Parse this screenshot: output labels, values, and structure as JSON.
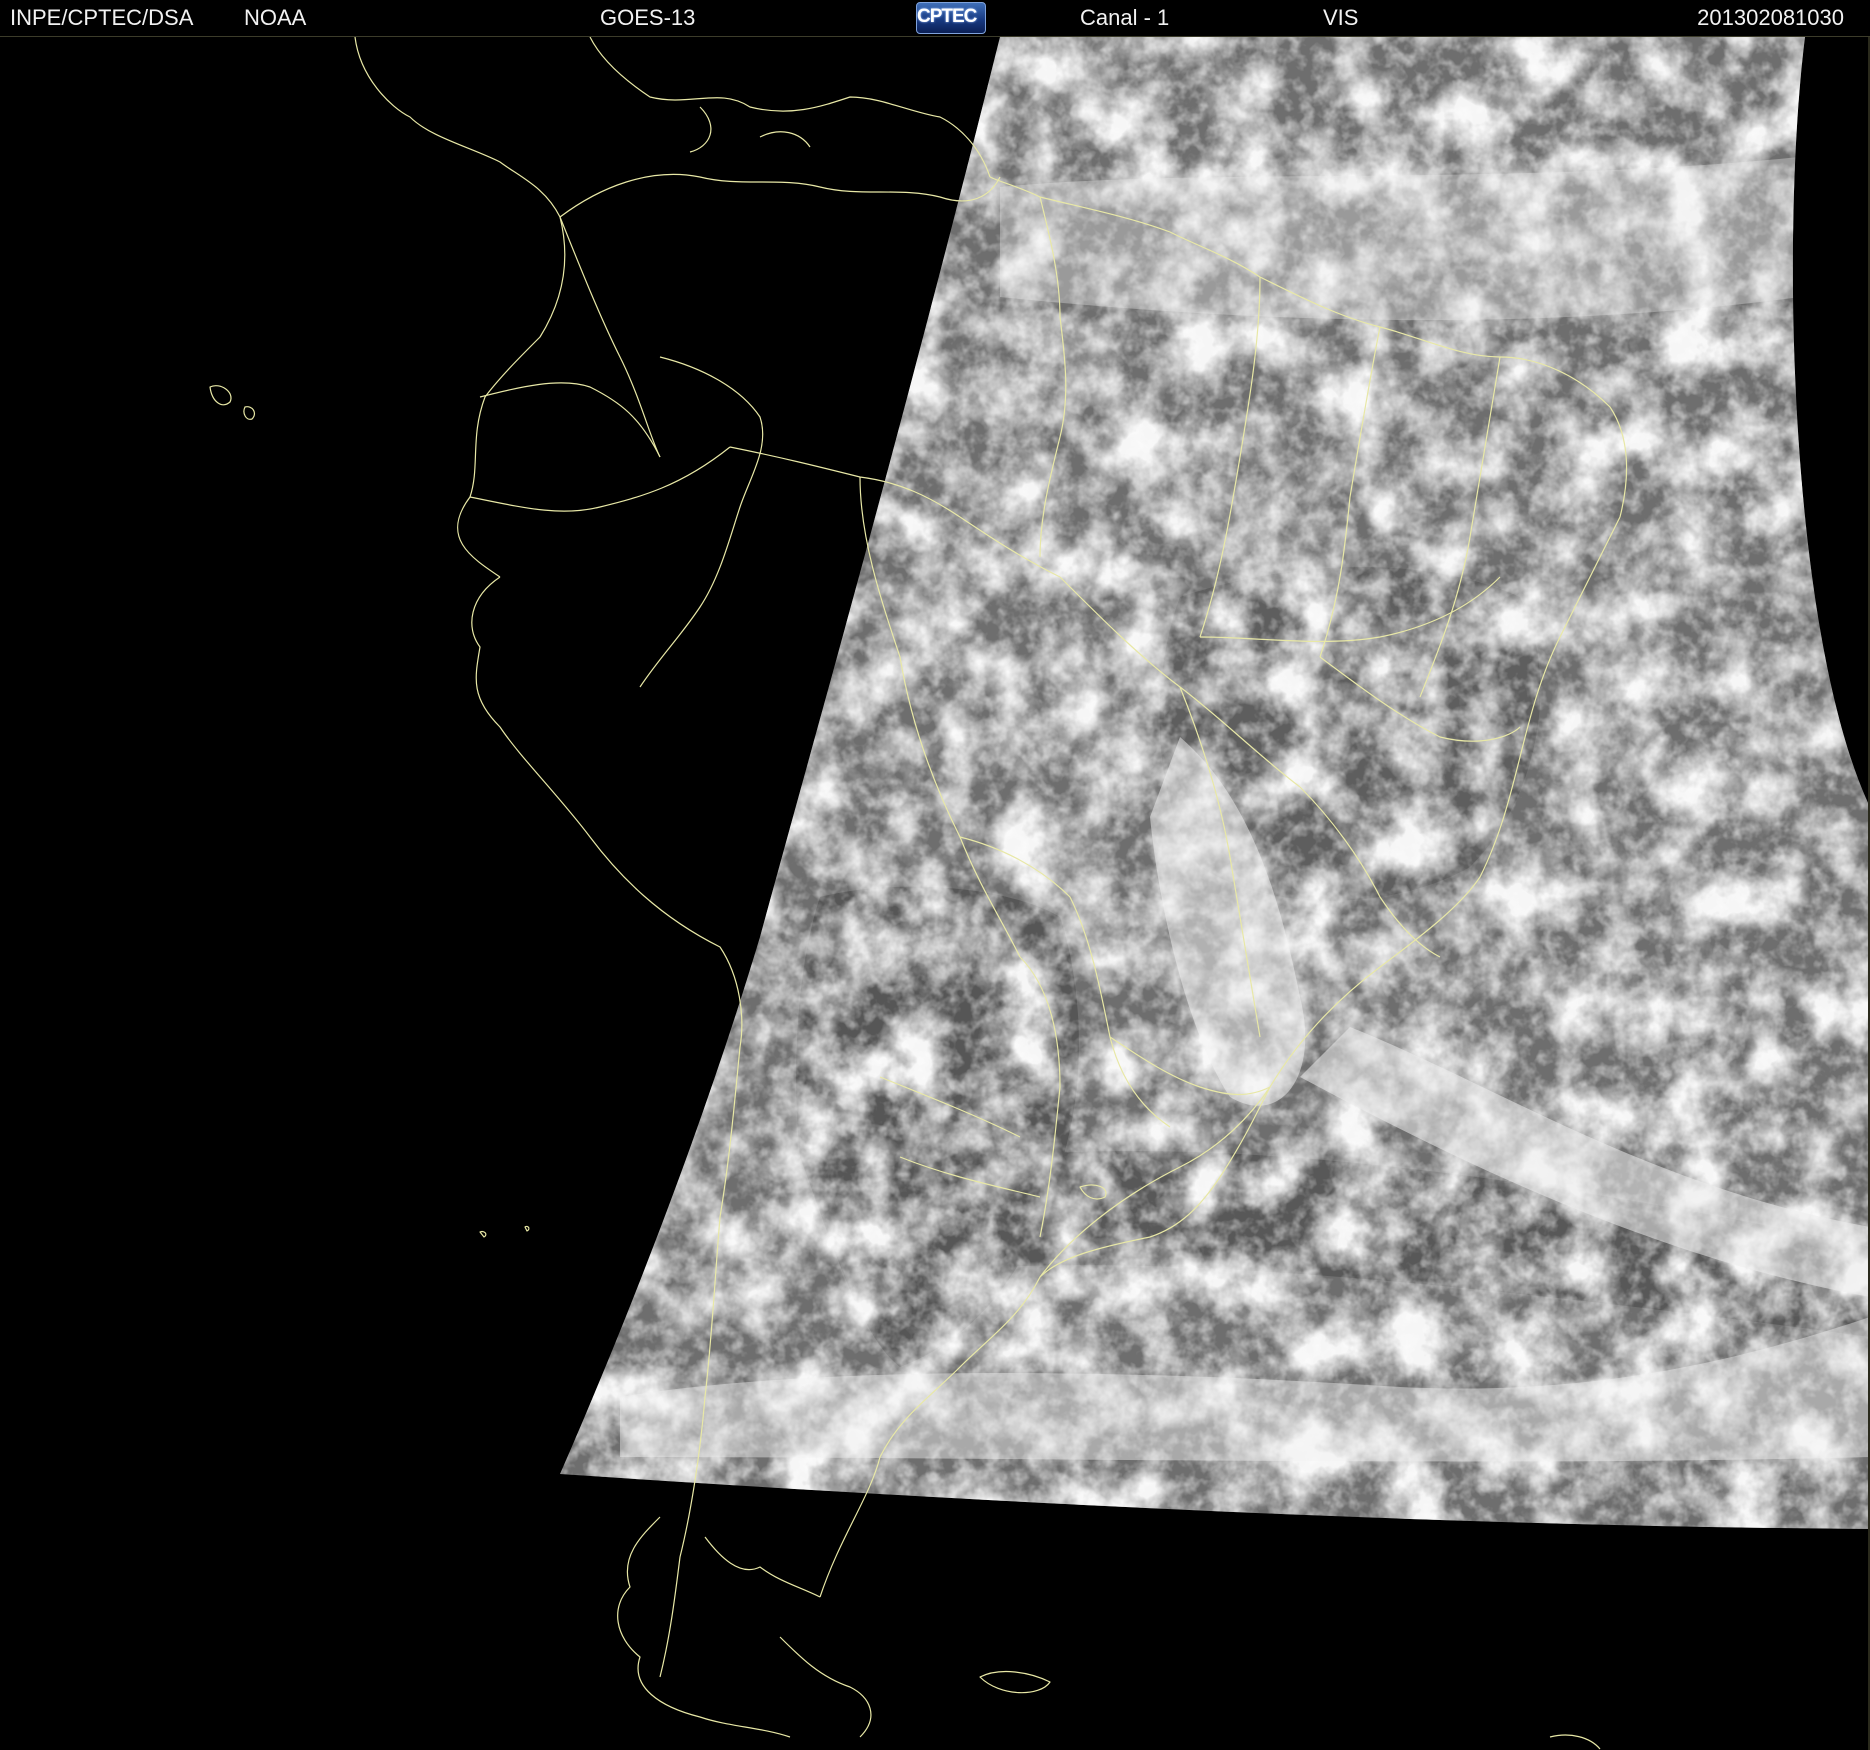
{
  "header": {
    "agency": "INPE/CPTEC/DSA",
    "source": "NOAA",
    "satellite": "GOES-13",
    "logo_text": "CPTEC",
    "channel": "Canal - 1",
    "band": "VIS",
    "timestamp": "201302081030"
  },
  "colors": {
    "background": "#000000",
    "header_text": "#f2f2f2",
    "border_lines": "#e8e8a6",
    "cloud_bright": "#f4f4f4",
    "ocean_gray": "#6e6e6e",
    "land_gray": "#595959",
    "logo_blue": "#183a82"
  },
  "icons": {
    "logo": "cptec-logo"
  }
}
